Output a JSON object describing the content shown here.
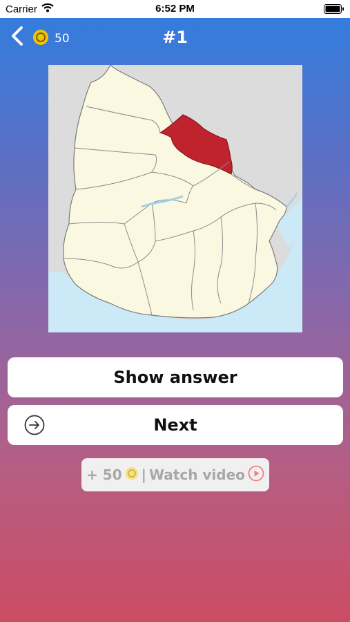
{
  "status_bar": {
    "carrier": "Carrier",
    "time": "6:52 PM"
  },
  "nav": {
    "coins": "50",
    "title": "#1"
  },
  "buttons": {
    "show_answer": "Show answer",
    "next": "Next"
  },
  "reward": {
    "prefix": "+ 50",
    "separator": "|",
    "label": "Watch video"
  },
  "icons": {
    "back": "chevron-left-icon",
    "coin": "coin-icon",
    "next": "arrow-circle-right-icon",
    "play": "play-circle-icon",
    "wifi": "wifi-icon",
    "battery": "battery-icon"
  },
  "colors": {
    "gradient_top": "#2f7ee0",
    "gradient_bottom": "#cc4c62",
    "highlight_region": "#c0232e",
    "map_land": "#fbf8e1",
    "water": "#cce9f7",
    "coin": "#f2c500"
  }
}
